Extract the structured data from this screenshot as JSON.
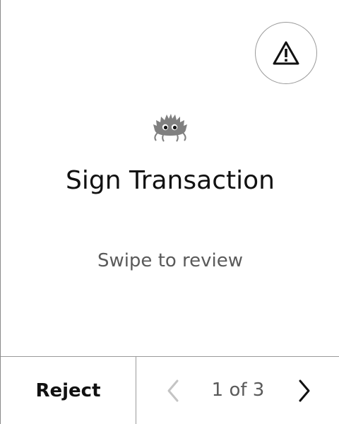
{
  "header": {
    "warning_icon": "warning-triangle-icon"
  },
  "main": {
    "logo_icon": "crab-icon",
    "title": "Sign Transaction",
    "subtitle": "Swipe to review"
  },
  "footer": {
    "reject_label": "Reject",
    "prev_icon": "chevron-left-icon",
    "next_icon": "chevron-right-icon",
    "page_indicator": "1 of 3",
    "current_page": 1,
    "total_pages": 3
  },
  "colors": {
    "text": "#111111",
    "muted_text": "#5a5a5a",
    "border": "#9a9a9a",
    "disabled": "#c4c4c4",
    "crab": "#808080"
  }
}
